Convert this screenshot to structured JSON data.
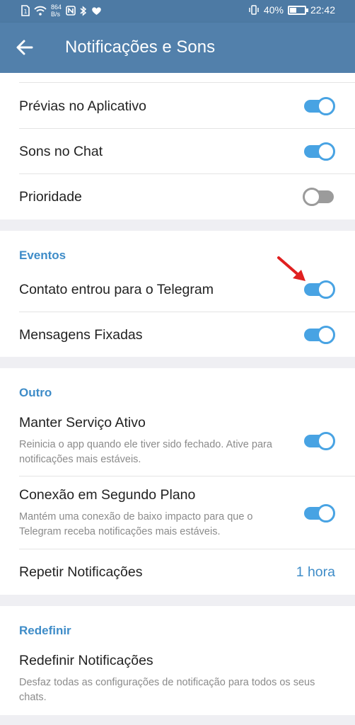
{
  "status": {
    "net_speed_value": "864",
    "net_speed_unit": "B/s",
    "battery": "40%",
    "time": "22:42"
  },
  "appbar": {
    "title": "Notificações e Sons"
  },
  "notifications": {
    "rows": [
      {
        "label": "Prévias no Aplicativo",
        "enabled": true
      },
      {
        "label": "Sons no Chat",
        "enabled": true
      },
      {
        "label": "Prioridade",
        "enabled": false
      }
    ]
  },
  "events": {
    "title": "Eventos",
    "rows": [
      {
        "label": "Contato entrou para o Telegram",
        "enabled": true
      },
      {
        "label": "Mensagens Fixadas",
        "enabled": true
      }
    ]
  },
  "other": {
    "title": "Outro",
    "rows": [
      {
        "label": "Manter Serviço Ativo",
        "subtitle": "Reinicia o app quando ele tiver sido fechado. Ative para notificações mais estáveis.",
        "enabled": true
      },
      {
        "label": "Conexão em Segundo Plano",
        "subtitle": "Mantém uma conexão de baixo impacto para que o Telegram receba notificações mais estáveis.",
        "enabled": true
      }
    ],
    "repeat": {
      "label": "Repetir Notificações",
      "value": "1 hora"
    }
  },
  "reset": {
    "title": "Redefinir",
    "row": {
      "label": "Redefinir Notificações",
      "subtitle": "Desfaz todas as configurações de notificação para todos os seus chats."
    }
  },
  "colors": {
    "appbar": "#5280ab",
    "statusbar": "#4d7aa4",
    "accent": "#48a3e3",
    "section_title": "#3e8cc8",
    "annotation_arrow": "#e02020"
  },
  "icons": {
    "statusbar_left": [
      "sim-icon",
      "wifi-icon",
      "nfc-icon",
      "bluetooth-icon",
      "heart-icon"
    ],
    "statusbar_right": [
      "vibrate-icon",
      "battery-icon"
    ],
    "appbar": [
      "back-arrow-icon"
    ]
  }
}
